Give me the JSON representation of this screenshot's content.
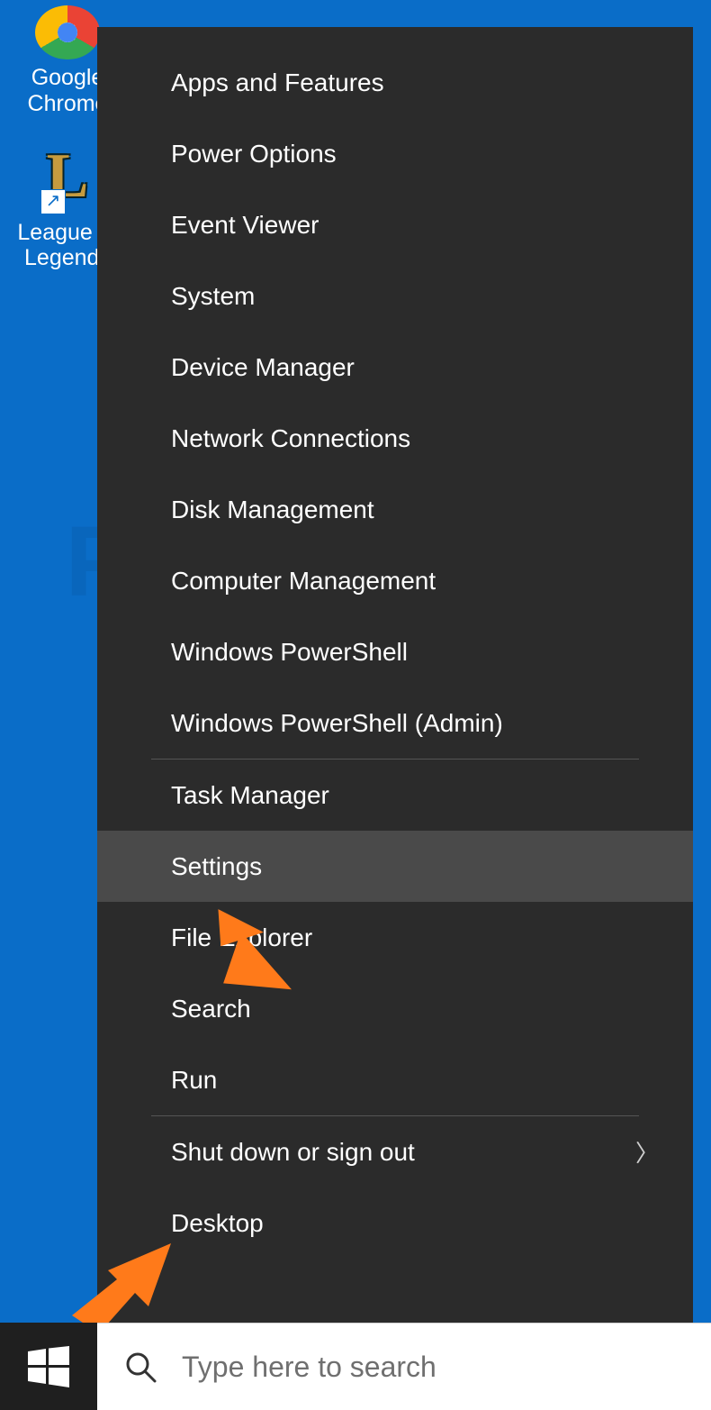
{
  "desktop": {
    "icon1_label": "Google Chrome",
    "icon2_label": "League of Legends"
  },
  "winx_menu": {
    "group1": [
      "Apps and Features",
      "Power Options",
      "Event Viewer",
      "System",
      "Device Manager",
      "Network Connections",
      "Disk Management",
      "Computer Management",
      "Windows PowerShell",
      "Windows PowerShell (Admin)"
    ],
    "group2": [
      "Task Manager",
      "Settings",
      "File Explorer",
      "Search",
      "Run"
    ],
    "group3": [
      {
        "label": "Shut down or sign out",
        "submenu": true
      },
      {
        "label": "Desktop",
        "submenu": false
      }
    ],
    "hovered": "Settings"
  },
  "taskbar": {
    "search_placeholder": "Type here to search"
  },
  "annotations": {
    "arrow_color": "#ff7a1a",
    "points_to": [
      "Settings",
      "Start button"
    ]
  },
  "watermark": "PCrisk.com"
}
